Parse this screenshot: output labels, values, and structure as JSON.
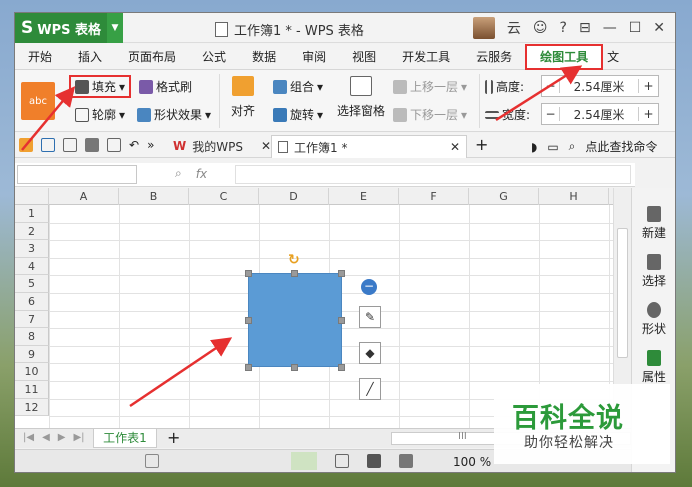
{
  "app": {
    "name": "WPS 表格",
    "logo": "S",
    "doc_title": "工作簿1 * - WPS 表格",
    "user": "云"
  },
  "window_controls": {
    "min": "—",
    "max": "☐",
    "close": "✕",
    "sep": "?",
    "toggle": "⊟"
  },
  "tabs": [
    "开始",
    "插入",
    "页面布局",
    "公式",
    "数据",
    "审阅",
    "视图",
    "开发工具",
    "云服务",
    "绘图工具",
    "文"
  ],
  "active_tab": "绘图工具",
  "ribbon": {
    "fill": "填充",
    "format_painter": "格式刷",
    "outline": "轮廓",
    "shape_effect": "形状效果",
    "align": "对齐",
    "group": "组合",
    "rotate": "旋转",
    "select_pane": "选择窗格",
    "bring_forward": "上移一层",
    "send_backward": "下移一层",
    "height_label": "高度:",
    "height_value": "2.54厘米",
    "width_label": "宽度:",
    "width_value": "2.54厘米",
    "minus": "−",
    "plus": "+",
    "style_label": "abc"
  },
  "quick_access": {
    "doc_tab1": "我的WPS",
    "doc_tab2": "工作簿1 *",
    "add": "+",
    "find": "点此查找命令"
  },
  "formula": {
    "fx": "fx",
    "namebox": ""
  },
  "columns": [
    "A",
    "B",
    "C",
    "D",
    "E",
    "F",
    "G",
    "H"
  ],
  "rows": [
    "1",
    "2",
    "3",
    "4",
    "5",
    "6",
    "7",
    "8",
    "9",
    "10",
    "11",
    "12"
  ],
  "side_panel": [
    "新建",
    "选择",
    "形状",
    "属性"
  ],
  "sheet_tabs": {
    "sheet1": "工作表1",
    "add": "+"
  },
  "status": {
    "zoom": "100 %",
    "ruler": "III"
  },
  "watermark": {
    "title": "百科全说",
    "subtitle": "助你轻松解决"
  },
  "colors": {
    "accent": "#2e8b3a",
    "shape": "#5b9bd5",
    "highlight": "#e63030"
  }
}
